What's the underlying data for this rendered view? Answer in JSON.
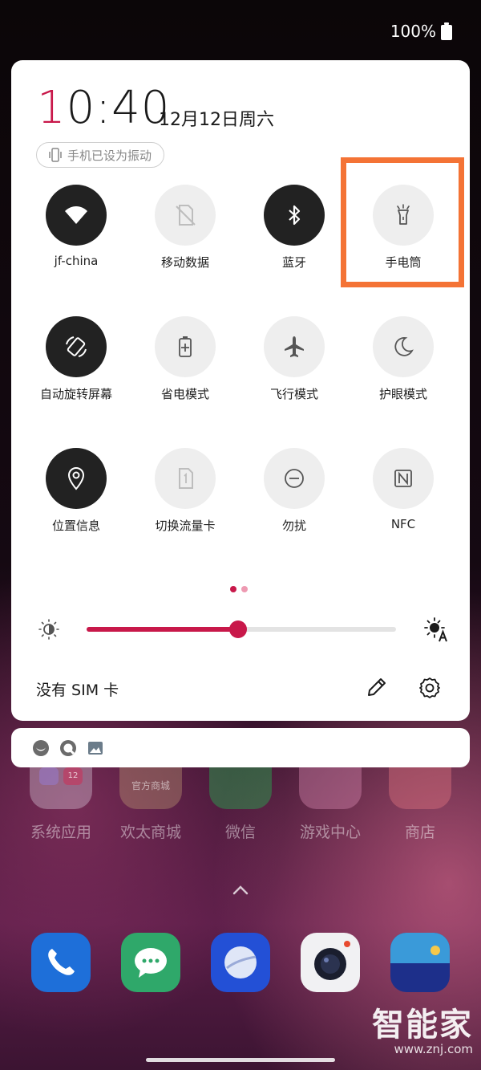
{
  "status_bar": {
    "battery_text": "100%",
    "battery_icon": "battery-full-icon"
  },
  "quick_panel": {
    "time_first_digit": "1",
    "time_rest": "0:40",
    "date": "12月12日周六",
    "ringer_status": "手机已设为振动",
    "tiles": [
      {
        "label": "jf-china",
        "icon": "wifi-icon",
        "on": true
      },
      {
        "label": "移动数据",
        "icon": "mobile-data-off-icon",
        "on": false
      },
      {
        "label": "蓝牙",
        "icon": "bluetooth-icon",
        "on": true
      },
      {
        "label": "手电筒",
        "icon": "flashlight-icon",
        "on": false
      },
      {
        "label": "自动旋转屏幕",
        "icon": "auto-rotate-icon",
        "on": true
      },
      {
        "label": "省电模式",
        "icon": "battery-saver-icon",
        "on": false
      },
      {
        "label": "飞行模式",
        "icon": "airplane-icon",
        "on": false
      },
      {
        "label": "护眼模式",
        "icon": "moon-icon",
        "on": false
      },
      {
        "label": "位置信息",
        "icon": "location-icon",
        "on": true
      },
      {
        "label": "切换流量卡",
        "icon": "sim-card-icon",
        "on": false
      },
      {
        "label": "勿扰",
        "icon": "do-not-disturb-icon",
        "on": false
      },
      {
        "label": "NFC",
        "icon": "nfc-icon",
        "on": false
      }
    ],
    "highlighted_tile": "手电筒",
    "page_indicator": {
      "pages": 2,
      "current": 1
    },
    "brightness_level": 0.49,
    "sim_status": "没有 SIM 卡"
  },
  "notification_bar": {
    "icons": [
      "app-notification-icon",
      "message-notification-icon",
      "gallery-notification-icon"
    ]
  },
  "home_screen": {
    "apps": [
      {
        "label": "系统应用"
      },
      {
        "label": "欢太商城",
        "tile_text": "官方商城"
      },
      {
        "label": "微信"
      },
      {
        "label": "游戏中心"
      },
      {
        "label": "商店"
      }
    ],
    "system_apps_badge": "12",
    "dock": [
      "phone-icon",
      "messages-icon",
      "browser-icon",
      "camera-icon",
      "wallet-icon"
    ]
  },
  "watermark": {
    "brand": "智能家",
    "url": "www.znj.com"
  },
  "colors": {
    "accent": "#c8184a",
    "highlight": "#f47335",
    "tile_on": "#222222",
    "tile_off": "#eeeeee"
  }
}
